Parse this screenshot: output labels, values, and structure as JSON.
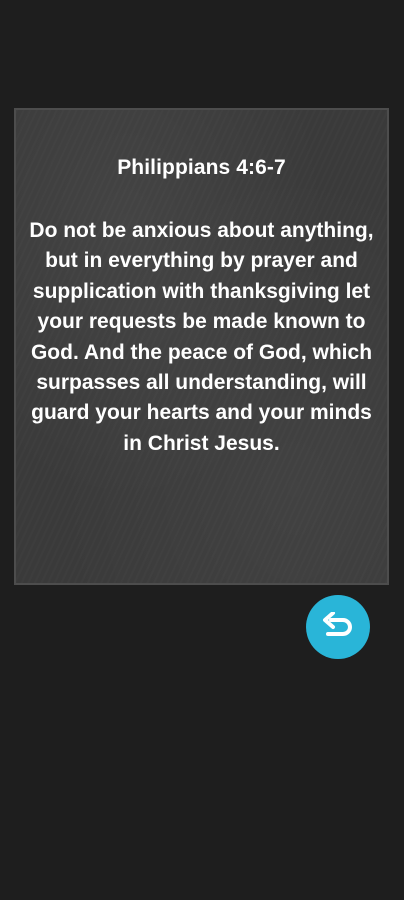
{
  "verse": {
    "reference": "Philippians 4:6-7",
    "text": "Do not be anxious about anything, but in everything by prayer and supplication with thanksgiving let your requests be made known to God. And the peace of God, which surpasses all understanding, will guard your hearts and your minds in Christ Jesus."
  },
  "back_button": {
    "icon": "undo-arrow-icon",
    "color": "#29b5d8"
  },
  "colors": {
    "background": "#1e1e1e",
    "card": "#3a3a3a",
    "text": "#ffffff"
  }
}
